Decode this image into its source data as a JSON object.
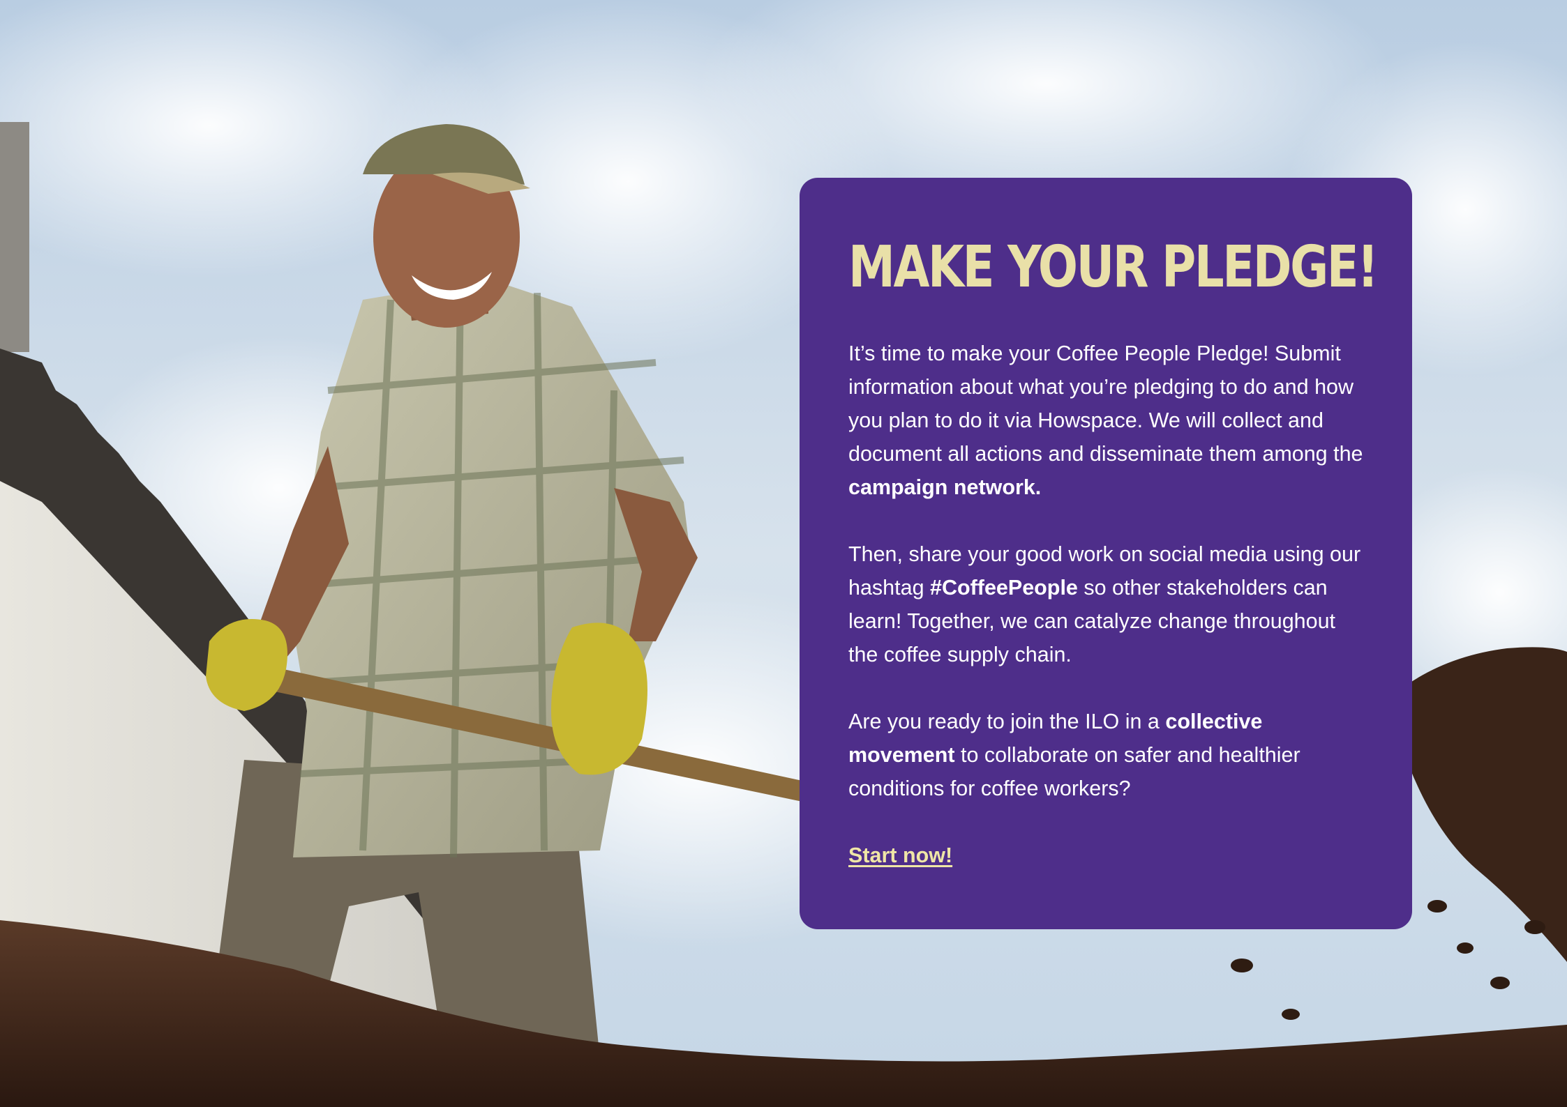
{
  "pledge": {
    "title": "MAKE YOUR PLEDGE!",
    "p1": {
      "text": "It’s time to make your Coffee People Pledge! Submit information about what you’re pledging to do and how you plan to do it via Howspace. We will collect and document all actions and disseminate them among the ",
      "bold": "campaign network."
    },
    "p2": {
      "before": "Then, share your good work on social media using our hashtag ",
      "hashtag": "#CoffeePeople",
      "after": " so other stakeholders can learn! Together, we can catalyze change throughout the coffee supply chain."
    },
    "p3": {
      "before": "Are you ready to join the ILO in a ",
      "bold": "collective movement",
      "after": " to collaborate on safer and healthier conditions for coffee workers?"
    },
    "cta_label": "Start now!"
  },
  "colors": {
    "card_background": "#4e2e8a",
    "title_color": "#e9e0a8",
    "cta_color": "#efe6a6",
    "body_text": "#ffffff"
  },
  "photo": {
    "icon": "coffee-farmer-photo"
  }
}
